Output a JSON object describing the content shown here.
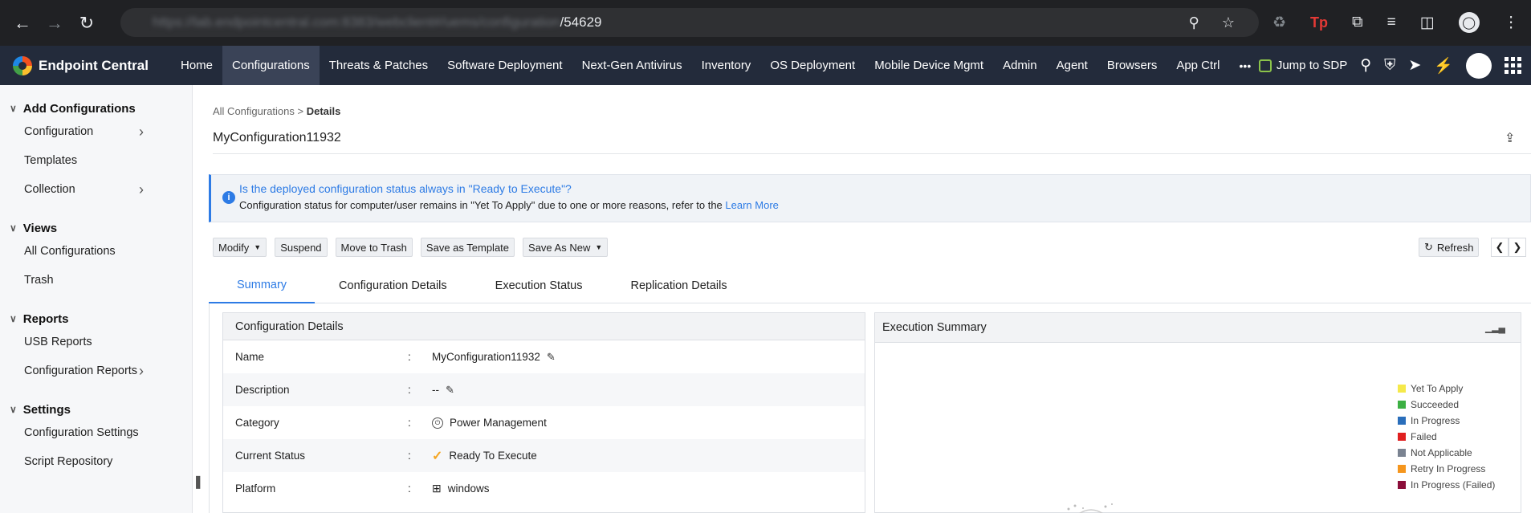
{
  "browser": {
    "url_blurred": "https://lab.endpointcentral.com:8383/webclient#/uems/configuration",
    "url_path": "/54629"
  },
  "app": {
    "brand": "Endpoint Central",
    "tabs": [
      "Home",
      "Configurations",
      "Threats & Patches",
      "Software Deployment",
      "Next-Gen Antivirus",
      "Inventory",
      "OS Deployment",
      "Mobile Device Mgmt",
      "Admin",
      "Agent",
      "Browsers",
      "App Ctrl"
    ],
    "active_tab": "Configurations",
    "more": "•••",
    "jump_label": "Jump to SDP"
  },
  "sidebar": {
    "groups": [
      {
        "title": "Add Configurations",
        "items": [
          {
            "label": "Configuration",
            "arrow": true
          },
          {
            "label": "Templates",
            "arrow": false
          },
          {
            "label": "Collection",
            "arrow": true
          }
        ]
      },
      {
        "title": "Views",
        "items": [
          {
            "label": "All Configurations",
            "arrow": false
          },
          {
            "label": "Trash",
            "arrow": false
          }
        ]
      },
      {
        "title": "Reports",
        "items": [
          {
            "label": "USB Reports",
            "arrow": false
          },
          {
            "label": "Configuration Reports",
            "arrow": true
          }
        ]
      },
      {
        "title": "Settings",
        "items": [
          {
            "label": "Configuration Settings",
            "arrow": false
          },
          {
            "label": "Script Repository",
            "arrow": false
          }
        ]
      }
    ]
  },
  "breadcrumb": {
    "parent": "All Configurations",
    "sep": ">",
    "current": "Details"
  },
  "page_title": "MyConfiguration11932",
  "info": {
    "question": "Is the deployed configuration status always in \"Ready to Execute\"?",
    "text": "Configuration status for computer/user remains in \"Yet To Apply\" due to one or more reasons, refer to the",
    "link": "Learn More"
  },
  "toolbar": {
    "modify": "Modify",
    "suspend": "Suspend",
    "move_to_trash": "Move to Trash",
    "save_as_template": "Save as Template",
    "save_as_new": "Save As New",
    "refresh": "Refresh"
  },
  "subtabs": [
    "Summary",
    "Configuration Details",
    "Execution Status",
    "Replication Details"
  ],
  "active_subtab": "Summary",
  "config_details": {
    "title": "Configuration Details",
    "rows": [
      {
        "key": "Name",
        "sep": ":",
        "value": "MyConfiguration11932"
      },
      {
        "key": "Description",
        "sep": ":",
        "value": "--"
      },
      {
        "key": "Category",
        "sep": ":",
        "value": "Power Management"
      },
      {
        "key": "Current Status",
        "sep": ":",
        "value": "Ready To Execute"
      },
      {
        "key": "Platform",
        "sep": ":",
        "value": "windows"
      }
    ]
  },
  "execution_summary": {
    "title": "Execution Summary",
    "legend": [
      {
        "label": "Yet To Apply",
        "color": "#f5e94a"
      },
      {
        "label": "Succeeded",
        "color": "#3cb043"
      },
      {
        "label": "In Progress",
        "color": "#2a6ebb"
      },
      {
        "label": "Failed",
        "color": "#e02020"
      },
      {
        "label": "Not Applicable",
        "color": "#7a8391"
      },
      {
        "label": "Retry In Progress",
        "color": "#f5961e"
      },
      {
        "label": "In Progress (Failed)",
        "color": "#8b0e3a"
      }
    ]
  }
}
